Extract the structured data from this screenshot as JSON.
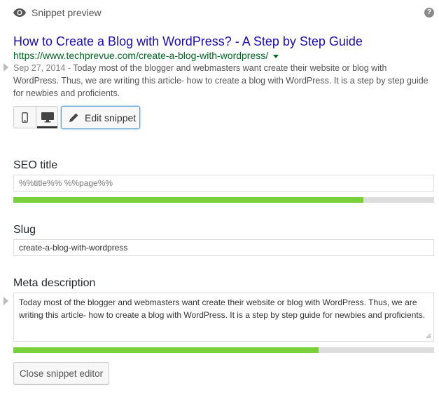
{
  "header": {
    "title": "Snippet preview",
    "icon": "eye-icon",
    "help_label": "?"
  },
  "serp": {
    "title": "How to Create a Blog with WordPress? - A Step by Step Guide",
    "url": "https://www.techprevue.com/create-a-blog-with-wordpress/",
    "date": "Sep 27, 2014 - ",
    "description": "Today most of the blogger and webmasters want create their website or blog with WordPress. Thus, we are writing this article- how to create a blog with WordPress. It is a step by step guide for newbies and proficients."
  },
  "modes": {
    "active": "desktop",
    "edit_label": "Edit snippet"
  },
  "seo_title": {
    "label": "SEO title",
    "value": "%%title%% %%page%%",
    "progress": 0.832
  },
  "slug": {
    "label": "Slug",
    "value": "create-a-blog-with-wordpress"
  },
  "meta_description": {
    "label": "Meta description",
    "value": "Today most of the blogger and webmasters want create their website or blog with WordPress. Thus, we are writing this article- how to create a blog with WordPress. It is a step by step guide for newbies and proficients.",
    "progress": 0.725
  },
  "footer": {
    "close_label": "Close snippet editor"
  },
  "colors": {
    "link_blue": "#1a0dab",
    "url_green": "#006621",
    "progress_good": "#7ad03a",
    "progress_track": "#dddddd"
  }
}
